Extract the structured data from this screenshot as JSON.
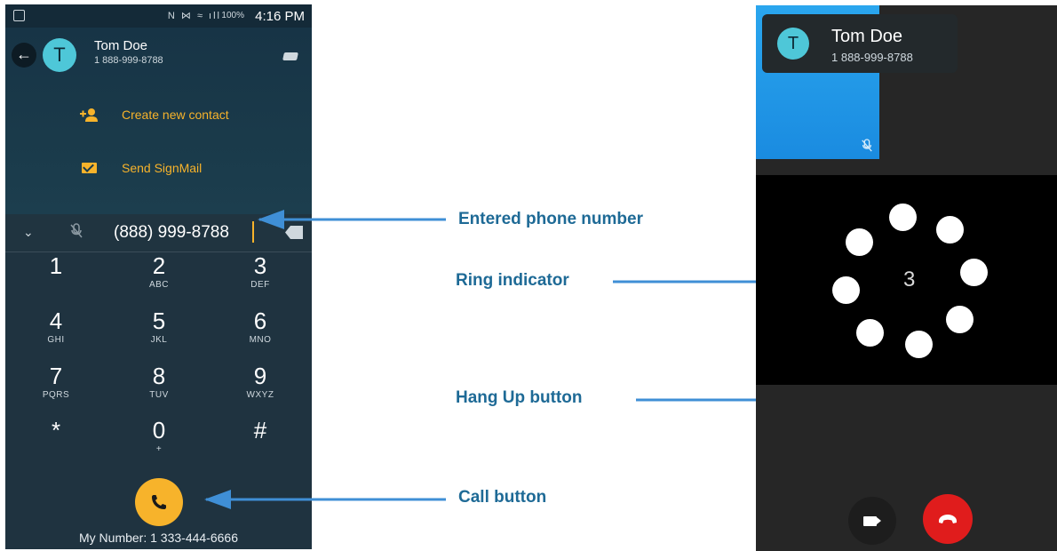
{
  "left_phone": {
    "status_bar": {
      "icons": "N  ⋈  ≈  ıll",
      "battery": "100%",
      "time": "4:16 PM"
    },
    "contact": {
      "initial": "T",
      "name": "Tom Doe",
      "phone": "1 888-999-8788"
    },
    "actions": [
      {
        "label": "Create new contact",
        "icon": "add-person-icon"
      },
      {
        "label": "Send SignMail",
        "icon": "mail-icon"
      }
    ],
    "entered_number": "(888) 999-8788",
    "keypad": [
      {
        "digit": "1",
        "letters": ""
      },
      {
        "digit": "2",
        "letters": "ABC"
      },
      {
        "digit": "3",
        "letters": "DEF"
      },
      {
        "digit": "4",
        "letters": "GHI"
      },
      {
        "digit": "5",
        "letters": "JKL"
      },
      {
        "digit": "6",
        "letters": "MNO"
      },
      {
        "digit": "7",
        "letters": "PQRS"
      },
      {
        "digit": "8",
        "letters": "TUV"
      },
      {
        "digit": "9",
        "letters": "WXYZ"
      },
      {
        "digit": "*",
        "letters": ""
      },
      {
        "digit": "0",
        "letters": "+"
      },
      {
        "digit": "#",
        "letters": ""
      }
    ],
    "my_number": "My Number: 1 333-444-6666",
    "colors": {
      "accent": "#f7b32b",
      "background": "#1f3340"
    }
  },
  "right_phone": {
    "contact": {
      "initial": "T",
      "name": "Tom Doe",
      "phone": "1 888-999-8788"
    },
    "ring_count": "3",
    "colors": {
      "hangup": "#e01c1c",
      "self_video": "#2aa6ee"
    }
  },
  "annotations": {
    "entered_number": "Entered phone number",
    "ring_indicator": "Ring indicator",
    "hang_up": "Hang Up button",
    "call_button": "Call button",
    "color": "#1e6a96",
    "arrow_color": "#3f8fd6"
  }
}
